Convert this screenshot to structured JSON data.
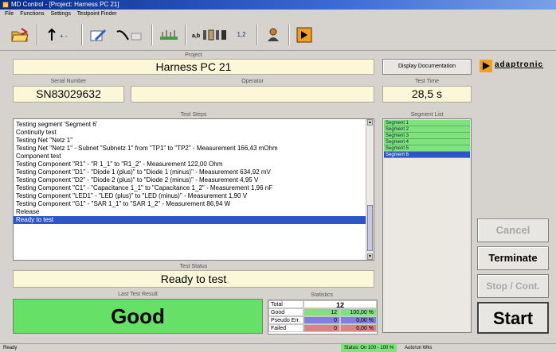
{
  "window": {
    "title": "MD Control - [Project: Harness PC 21]"
  },
  "menu": [
    "File",
    "Functions",
    "Settings",
    "Testpoint Finder"
  ],
  "toolbar": {
    "count_label": "1,2"
  },
  "project": {
    "label": "Project",
    "value": "Harness PC 21",
    "doc_button": "Display Documentation"
  },
  "brand": {
    "name": "adaptronic",
    "accent": "#f0a020"
  },
  "serial": {
    "label": "Serial Number",
    "value": "SN83029632"
  },
  "operator": {
    "label": "Operator",
    "value": ""
  },
  "test_time": {
    "label": "Test Time",
    "value": "28,5 s"
  },
  "test_steps": {
    "label": "Test Steps",
    "items": [
      "Testing segment 'Segment 6'",
      "Continuity test",
      "Testing Net \"Netz 1\"",
      "Testing Net \"Netz 1\" - Subnet \"Subnetz 1\" from \"TP1\" to \"TP2\" - Measurement 166,43 mOhm",
      "Component test",
      "Testing Component \"R1\" - \"R 1_1\" to \"R1_2\" - Measurement 122,00 Ohm",
      "Testing Component \"D1\" - \"Diode 1 (plus)\" to \"Diode 1 (minus)\" - Measurement 634,92 mV",
      "Testing Component \"D2\" - \"Diode 2 (plus)\" to \"Diode 2 (minus)\" - Measurement 4,95 V",
      "Testing Component \"C1\" - \"Capacitance 1_1\" to \"Capacitance 1_2\" - Measurement 1,96 nF",
      "Testing Component \"LED1\" - \"LED (plus)\" to \"LED (minus)\" - Measurement 1,90 V",
      "Testing Component \"G1\" - \"SAR 1_1\" to \"SAR 1_2\" - Measurement 86,94 W",
      "Release",
      "Ready to test"
    ],
    "selected_index": 12
  },
  "segment_list": {
    "label": "Segment List",
    "items": [
      "Segment 1",
      "Segment 2",
      "Segment 3",
      "Segment 4",
      "Segment 5",
      "Segment 6"
    ],
    "selected_index": 5
  },
  "test_status": {
    "label": "Test Status",
    "value": "Ready to test"
  },
  "last_result": {
    "label": "Last Test Result",
    "value": "Good",
    "color": "#66e066"
  },
  "statistics": {
    "label": "Statistics",
    "total": {
      "label": "Total",
      "value": "12"
    },
    "rows": [
      {
        "label": "Good",
        "count": "12",
        "percent": "100,00 %",
        "color": "#7fe27f"
      },
      {
        "label": "Pseudo Err.",
        "count": "0",
        "percent": "0,00 %",
        "color": "#8080e0"
      },
      {
        "label": "Failed",
        "count": "0",
        "percent": "0,00 %",
        "color": "#e08080"
      }
    ]
  },
  "buttons": {
    "cancel": "Cancel",
    "terminate": "Terminate",
    "stop_cont": "Stop / Cont.",
    "start": "Start"
  },
  "statusbar": {
    "left": "Ready",
    "mid1": "Status: On 100 - 100 %",
    "mid2": "Autorun Wks"
  }
}
